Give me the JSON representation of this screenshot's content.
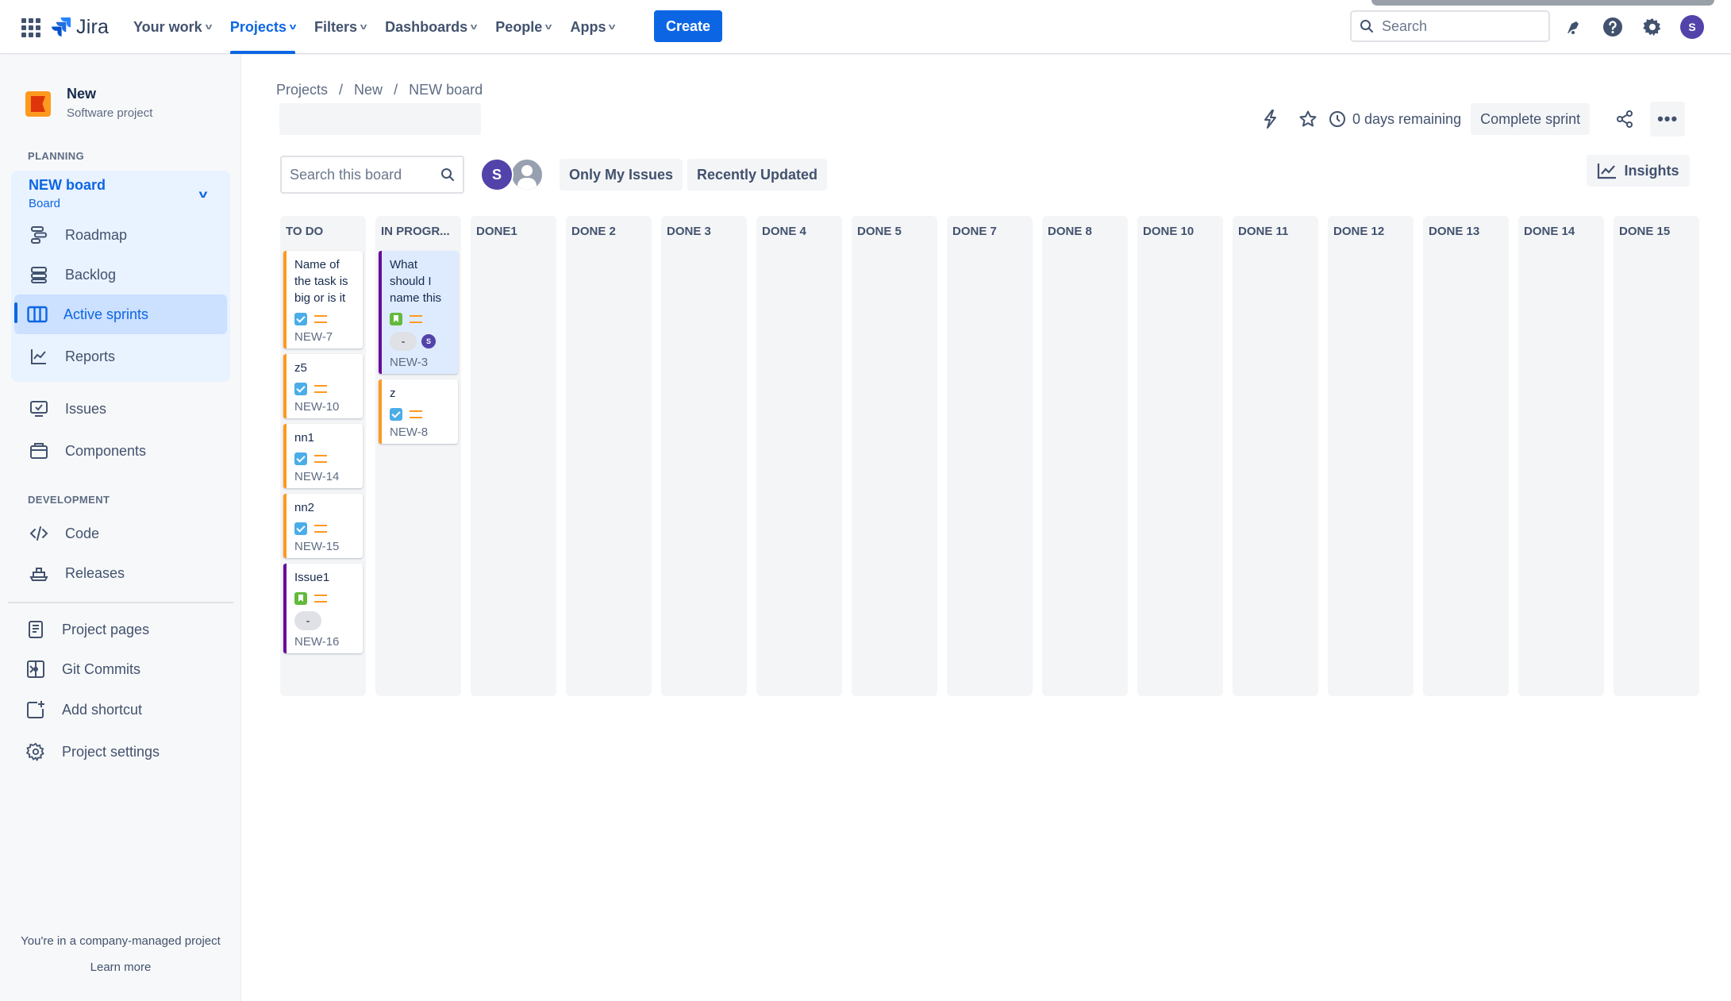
{
  "topnav": {
    "logo_text": "Jira",
    "items": [
      {
        "label": "Your work",
        "active": false
      },
      {
        "label": "Projects",
        "active": true
      },
      {
        "label": "Filters",
        "active": false
      },
      {
        "label": "Dashboards",
        "active": false
      },
      {
        "label": "People",
        "active": false
      },
      {
        "label": "Apps",
        "active": false
      }
    ],
    "create_label": "Create",
    "search_placeholder": "Search",
    "avatar_initial": "S",
    "icons": [
      "notifications-icon",
      "help-icon",
      "settings-icon"
    ]
  },
  "sidebar": {
    "project_name": "New",
    "project_type": "Software project",
    "planning_label": "PLANNING",
    "board_name": "NEW board",
    "board_sub": "Board",
    "planning_items": [
      {
        "label": "Roadmap",
        "icon": "roadmap-icon"
      },
      {
        "label": "Backlog",
        "icon": "backlog-icon"
      },
      {
        "label": "Active sprints",
        "icon": "board-columns-icon",
        "active": true
      },
      {
        "label": "Reports",
        "icon": "reports-icon"
      }
    ],
    "other_items": [
      {
        "label": "Issues",
        "icon": "issues-icon"
      },
      {
        "label": "Components",
        "icon": "components-icon"
      }
    ],
    "development_label": "DEVELOPMENT",
    "dev_items": [
      {
        "label": "Code",
        "icon": "code-icon"
      },
      {
        "label": "Releases",
        "icon": "releases-icon"
      }
    ],
    "bottom_items": [
      {
        "label": "Project pages",
        "icon": "pages-icon"
      },
      {
        "label": "Git Commits",
        "icon": "git-commits-icon"
      },
      {
        "label": "Add shortcut",
        "icon": "add-shortcut-icon"
      },
      {
        "label": "Project settings",
        "icon": "gear-icon"
      }
    ],
    "footer_note": "You're in a company-managed project",
    "learn_more": "Learn more"
  },
  "main": {
    "breadcrumb": [
      "Projects",
      "New",
      "NEW board"
    ],
    "days_remaining": "0 days remaining",
    "complete_sprint": "Complete sprint",
    "board_search_placeholder": "Search this board",
    "assignee_initial": "S",
    "filters": [
      "Only My Issues",
      "Recently Updated"
    ],
    "insights": "Insights"
  },
  "board": {
    "columns": [
      {
        "name": "TO DO",
        "cards": [
          {
            "title": "Name of the task is big or is it",
            "type": "task",
            "priority": "medium",
            "key": "NEW-7",
            "epic_color": "orange"
          },
          {
            "title": "z5",
            "type": "task",
            "priority": "medium",
            "key": "NEW-10",
            "epic_color": "orange"
          },
          {
            "title": "nn1",
            "type": "task",
            "priority": "medium",
            "key": "NEW-14",
            "epic_color": "orange"
          },
          {
            "title": "nn2",
            "type": "task",
            "priority": "medium",
            "key": "NEW-15",
            "epic_color": "orange"
          },
          {
            "title": "Issue1",
            "type": "story",
            "priority": "medium",
            "estimate": "-",
            "key": "NEW-16",
            "epic_color": "purple"
          }
        ]
      },
      {
        "name": "IN PROGR...",
        "cards": [
          {
            "title": "What should I name this",
            "type": "story",
            "priority": "medium",
            "estimate": "-",
            "assignee": "S",
            "key": "NEW-3",
            "epic_color": "purple",
            "selected": true
          },
          {
            "title": "z",
            "type": "task",
            "priority": "medium",
            "key": "NEW-8",
            "epic_color": "orange"
          }
        ]
      },
      {
        "name": "DONE1",
        "cards": []
      },
      {
        "name": "DONE 2",
        "cards": []
      },
      {
        "name": "DONE 3",
        "cards": []
      },
      {
        "name": "DONE 4",
        "cards": []
      },
      {
        "name": "DONE 5",
        "cards": []
      },
      {
        "name": "DONE 7",
        "cards": []
      },
      {
        "name": "DONE 8",
        "cards": []
      },
      {
        "name": "DONE 10",
        "cards": []
      },
      {
        "name": "DONE 11",
        "cards": []
      },
      {
        "name": "DONE 12",
        "cards": []
      },
      {
        "name": "DONE 13",
        "cards": []
      },
      {
        "name": "DONE 14",
        "cards": []
      },
      {
        "name": "DONE 15",
        "cards": []
      }
    ]
  }
}
